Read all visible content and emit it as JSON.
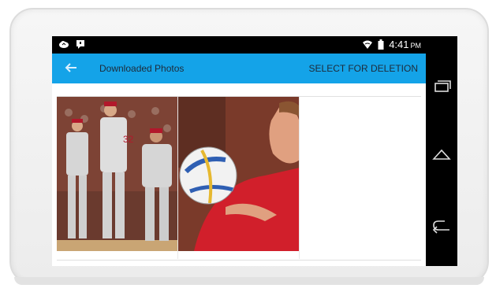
{
  "status": {
    "time": "4:41",
    "ampm": "PM",
    "left_icons": [
      "cloud-icon",
      "message-icon"
    ],
    "right_icons": [
      "wifi-icon",
      "battery-icon"
    ]
  },
  "appbar": {
    "title": "Downloaded Photos",
    "action": "SELECT FOR DELETION",
    "color": "#14a3e8"
  },
  "photos": [
    {
      "name": "baseball-team-photo"
    },
    {
      "name": "soccer-player-photo"
    }
  ],
  "navbar": {
    "buttons": [
      "recent-apps-icon",
      "home-icon",
      "back-icon"
    ]
  }
}
